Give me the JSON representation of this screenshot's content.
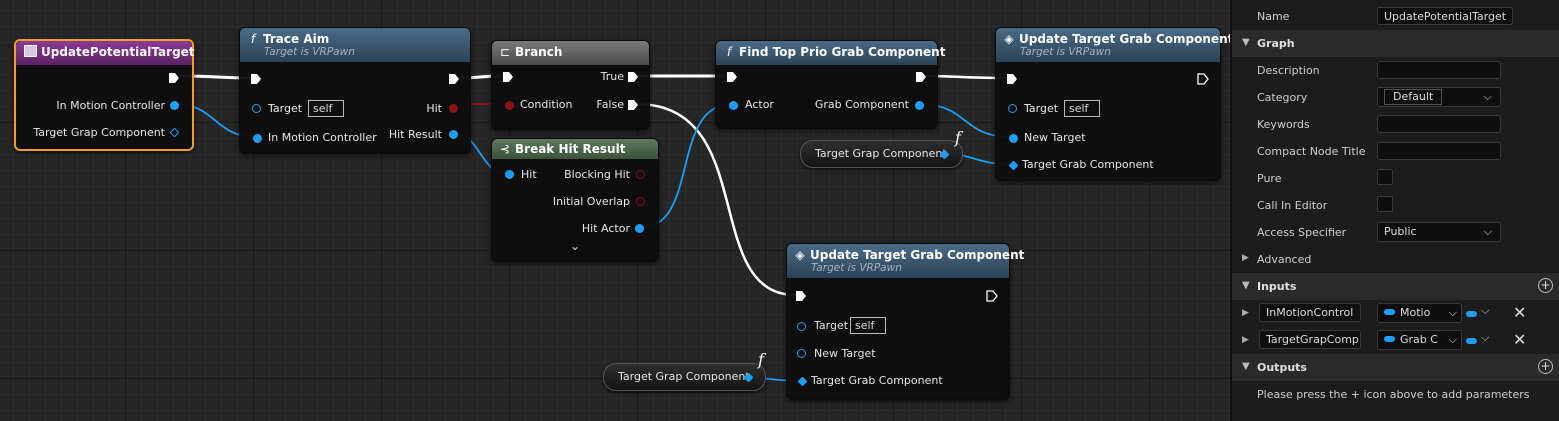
{
  "graph": {
    "event_node": {
      "title": "UpdatePotentialTarget",
      "pins": {
        "in_motion_controller": "In Motion Controller",
        "target_grap_component": "Target Grap Component"
      }
    },
    "trace_aim": {
      "icon": "f",
      "title": "Trace Aim",
      "subtitle": "Target is VRPawn",
      "target": "Target",
      "self": "self",
      "in_motion_controller": "In Motion Controller",
      "hit": "Hit",
      "hit_result": "Hit Result"
    },
    "branch": {
      "title": "Branch",
      "condition": "Condition",
      "true": "True",
      "false": "False"
    },
    "break_hit": {
      "title": "Break Hit Result",
      "hit": "Hit",
      "blocking_hit": "Blocking Hit",
      "initial_overlap": "Initial Overlap",
      "hit_actor": "Hit Actor",
      "expand": "⌄"
    },
    "find_top": {
      "icon": "f",
      "title": "Find Top Prio Grab Component",
      "actor": "Actor",
      "grab_component": "Grab Component"
    },
    "update_top": {
      "title": "Update Target Grab Component",
      "subtitle": "Target is VRPawn",
      "target": "Target",
      "self": "self",
      "new_target": "New Target",
      "target_grab_component": "Target Grab Component"
    },
    "update_bottom": {
      "title": "Update Target Grab Component",
      "subtitle": "Target is VRPawn",
      "target": "Target",
      "self": "self",
      "new_target": "New Target",
      "target_grab_component": "Target Grab Component"
    },
    "var_top": {
      "label": "Target Grap Component",
      "fsign": "f"
    },
    "var_bottom": {
      "label": "Target Grap Component",
      "fsign": "f"
    }
  },
  "panel": {
    "name_label": "Name",
    "name_value": "UpdatePotentialTarget",
    "graph_section": "Graph",
    "description": "Description",
    "category": "Category",
    "category_value": "Default",
    "keywords": "Keywords",
    "compact_node_title": "Compact Node Title",
    "pure": "Pure",
    "call_in_editor": "Call In Editor",
    "access_specifier": "Access Specifier",
    "access_value": "Public",
    "advanced": "Advanced",
    "inputs_section": "Inputs",
    "inputs": [
      {
        "name": "InMotionControl",
        "type": "Motio"
      },
      {
        "name": "TargetGrapComp",
        "type": "Grab C"
      }
    ],
    "outputs_section": "Outputs",
    "outputs_hint": "Please press the + icon above to add parameters"
  },
  "colors": {
    "function_header": "#3f5a73",
    "event_header": "#7a2f86",
    "object_pin": "#1e9ef4",
    "bool_pin": "#8f1010",
    "selected_border": "#f0a020"
  }
}
